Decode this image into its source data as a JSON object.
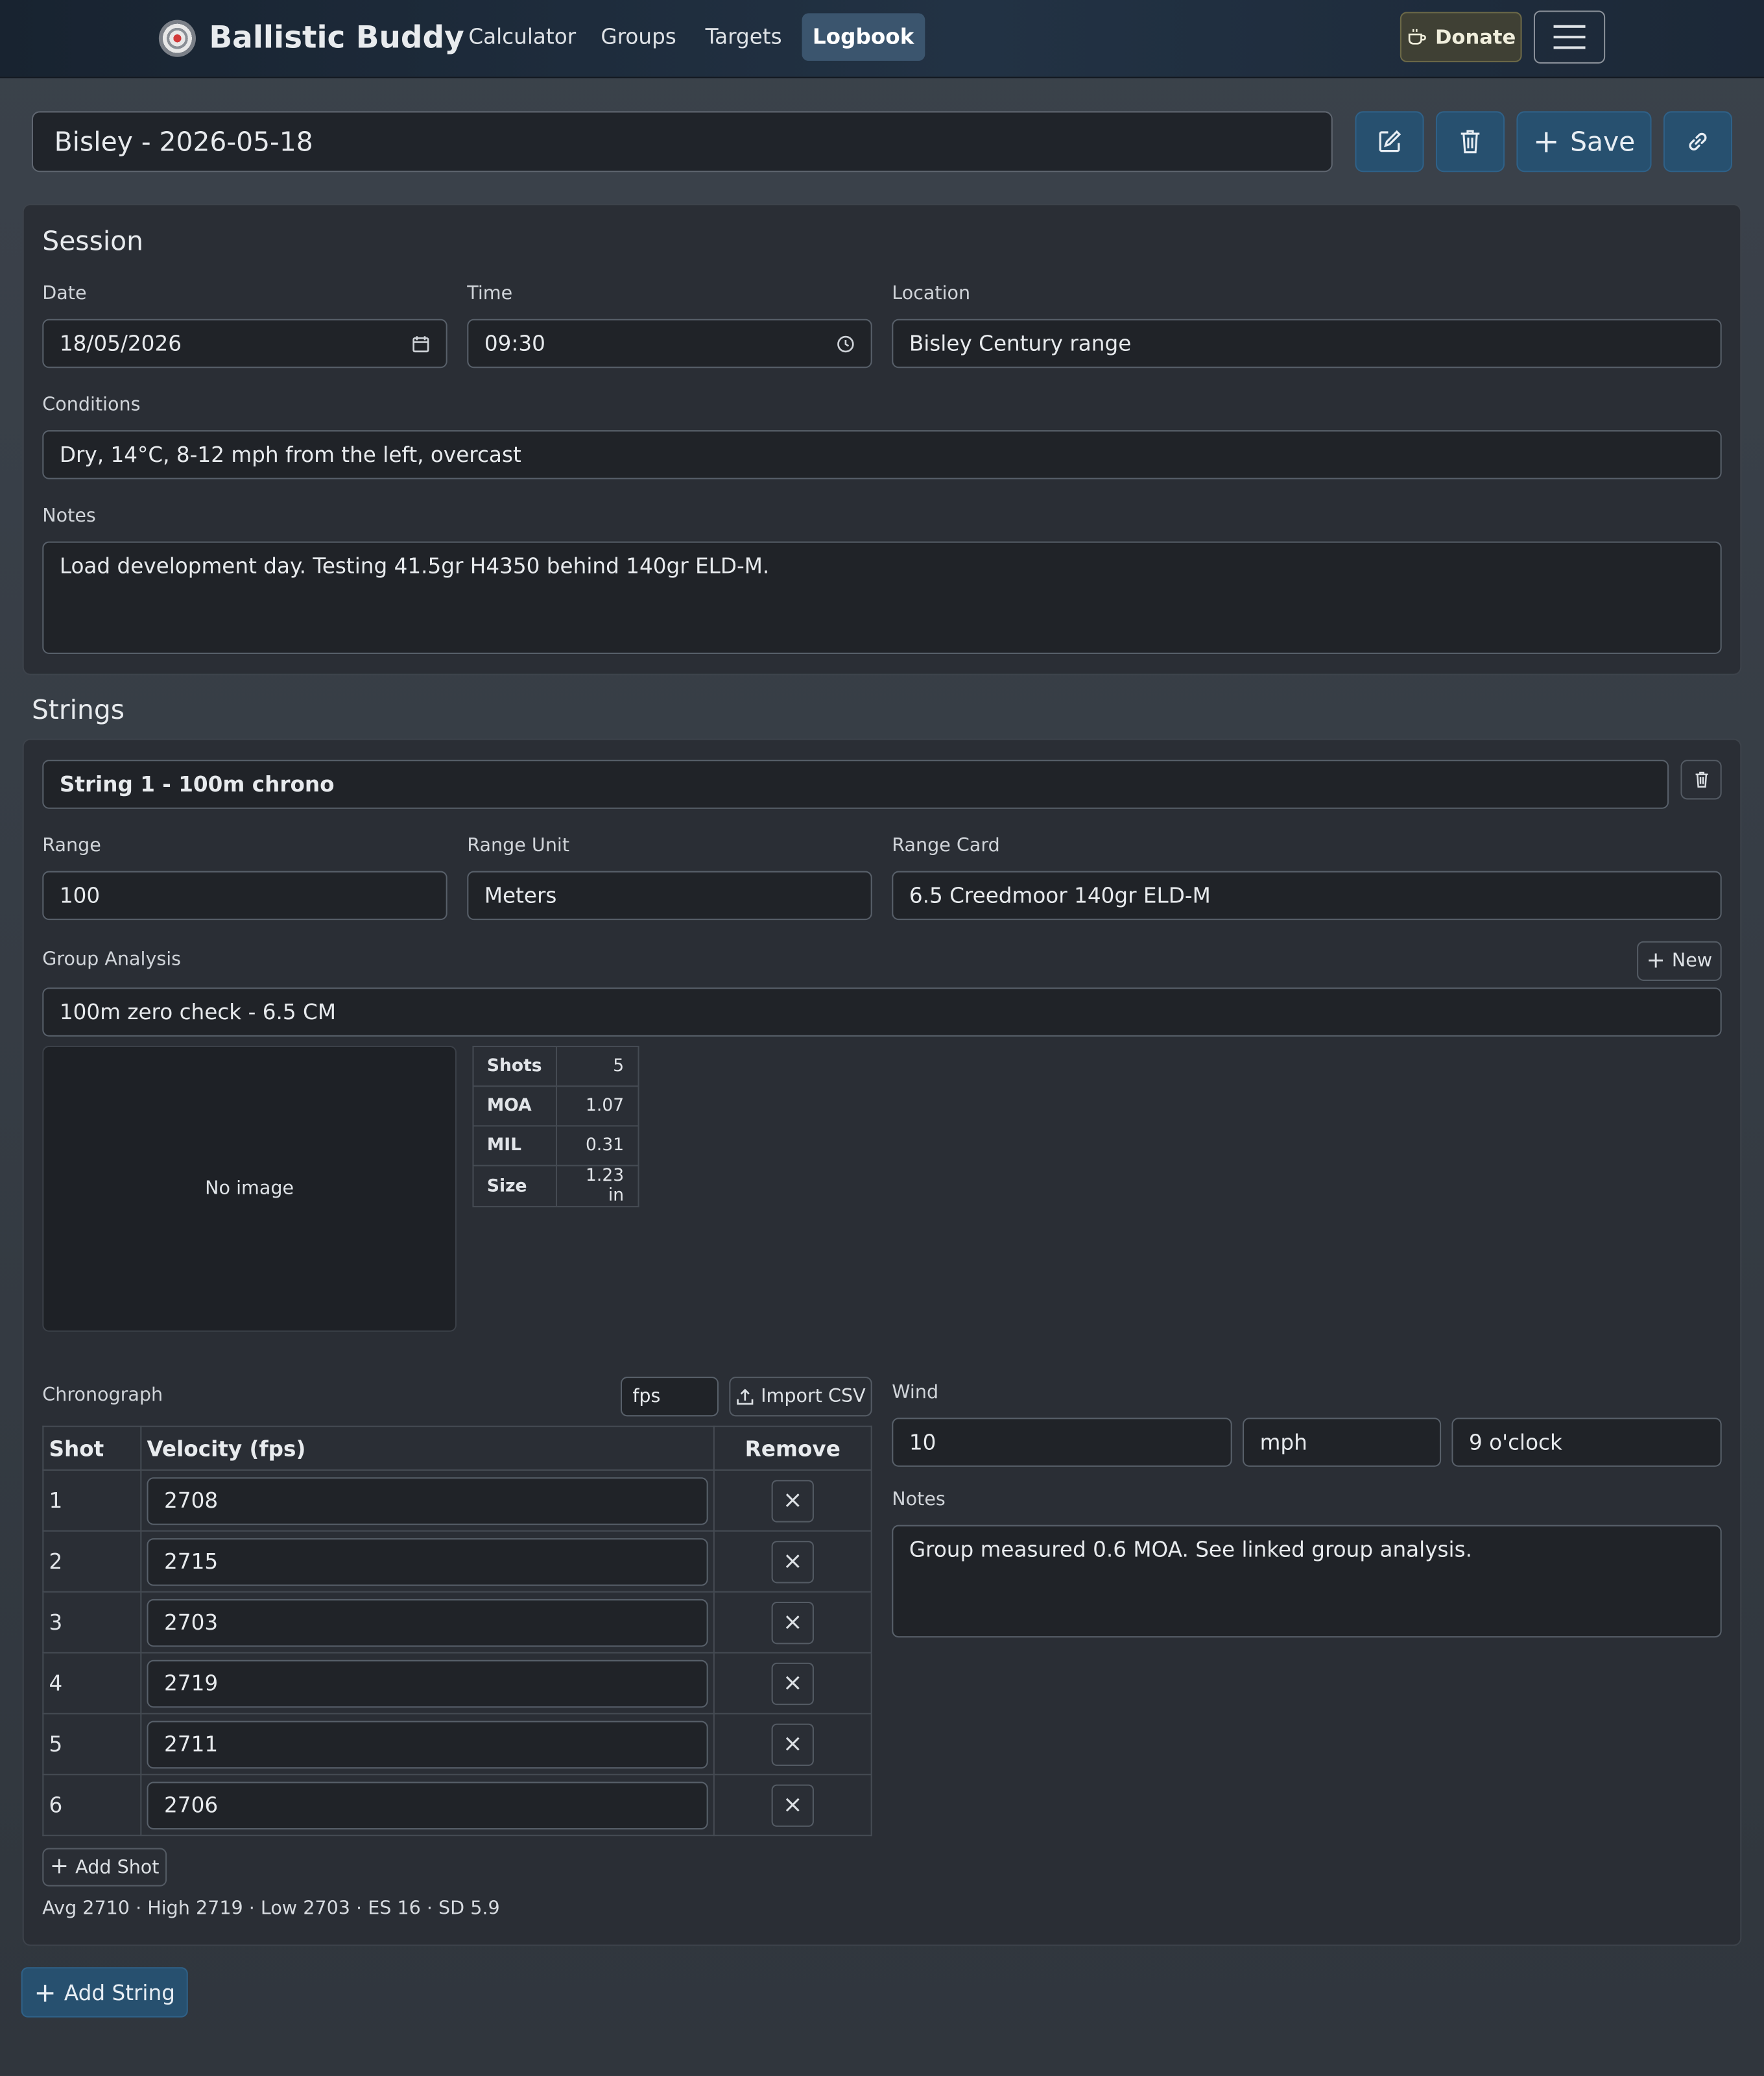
{
  "navbar": {
    "brand": "Ballistic Buddy",
    "links": [
      "Calculator",
      "Groups",
      "Targets",
      "Logbook"
    ],
    "active": "Logbook",
    "donate_label": "Donate"
  },
  "log": {
    "title": "Bisley - 2026-05-18",
    "save_label": "Save"
  },
  "session": {
    "heading": "Session",
    "date_label": "Date",
    "date_value": "18/05/2026",
    "time_label": "Time",
    "time_value": "09:30",
    "location_label": "Location",
    "location_value": "Bisley Century range",
    "conditions_label": "Conditions",
    "conditions_value": "Dry, 14°C, 8-12 mph from the left, overcast",
    "notes_label": "Notes",
    "notes_value": "Load development day. Testing 41.5gr H4350 behind 140gr ELD-M."
  },
  "strings": {
    "heading": "Strings",
    "add_string_label": "Add String",
    "items": [
      {
        "name": "String 1 - 100m chrono",
        "range_label": "Range",
        "range_value": "100",
        "range_unit_label": "Range Unit",
        "range_unit_value": "Meters",
        "range_card_label": "Range Card",
        "range_card_value": "6.5 Creedmoor 140gr ELD-M",
        "group_label": "Group Analysis",
        "new_label": "New",
        "group_value": "100m zero check - 6.5 CM",
        "no_image": "No image",
        "stats": [
          {
            "k": "Shots",
            "v": "5"
          },
          {
            "k": "MOA",
            "v": "1.07"
          },
          {
            "k": "MIL",
            "v": "0.31"
          },
          {
            "k": "Size",
            "v": "1.23 in"
          }
        ],
        "chrono_label": "Chronograph",
        "chrono_unit": "fps",
        "import_label": "Import CSV",
        "table_headers": [
          "Shot",
          "Velocity (fps)",
          "Remove"
        ],
        "shots": [
          {
            "n": "1",
            "v": "2708"
          },
          {
            "n": "2",
            "v": "2715"
          },
          {
            "n": "3",
            "v": "2703"
          },
          {
            "n": "4",
            "v": "2719"
          },
          {
            "n": "5",
            "v": "2711"
          },
          {
            "n": "6",
            "v": "2706"
          }
        ],
        "add_shot_label": "Add Shot",
        "summary": "Avg 2710 · High 2719 · Low 2703 · ES 16 · SD 5.9",
        "wind_label": "Wind",
        "wind_speed": "10",
        "wind_unit": "mph",
        "wind_dir": "9 o'clock",
        "notes_label": "Notes",
        "notes_value": "Group measured 0.6 MOA. See linked group analysis."
      }
    ]
  }
}
